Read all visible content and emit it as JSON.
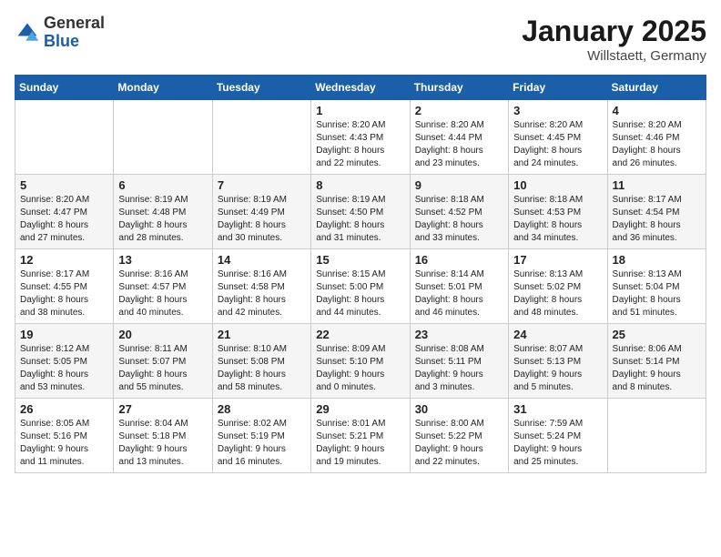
{
  "logo": {
    "general": "General",
    "blue": "Blue"
  },
  "title": "January 2025",
  "location": "Willstaett, Germany",
  "days_of_week": [
    "Sunday",
    "Monday",
    "Tuesday",
    "Wednesday",
    "Thursday",
    "Friday",
    "Saturday"
  ],
  "weeks": [
    [
      {
        "day": "",
        "info": ""
      },
      {
        "day": "",
        "info": ""
      },
      {
        "day": "",
        "info": ""
      },
      {
        "day": "1",
        "info": "Sunrise: 8:20 AM\nSunset: 4:43 PM\nDaylight: 8 hours\nand 22 minutes."
      },
      {
        "day": "2",
        "info": "Sunrise: 8:20 AM\nSunset: 4:44 PM\nDaylight: 8 hours\nand 23 minutes."
      },
      {
        "day": "3",
        "info": "Sunrise: 8:20 AM\nSunset: 4:45 PM\nDaylight: 8 hours\nand 24 minutes."
      },
      {
        "day": "4",
        "info": "Sunrise: 8:20 AM\nSunset: 4:46 PM\nDaylight: 8 hours\nand 26 minutes."
      }
    ],
    [
      {
        "day": "5",
        "info": "Sunrise: 8:20 AM\nSunset: 4:47 PM\nDaylight: 8 hours\nand 27 minutes."
      },
      {
        "day": "6",
        "info": "Sunrise: 8:19 AM\nSunset: 4:48 PM\nDaylight: 8 hours\nand 28 minutes."
      },
      {
        "day": "7",
        "info": "Sunrise: 8:19 AM\nSunset: 4:49 PM\nDaylight: 8 hours\nand 30 minutes."
      },
      {
        "day": "8",
        "info": "Sunrise: 8:19 AM\nSunset: 4:50 PM\nDaylight: 8 hours\nand 31 minutes."
      },
      {
        "day": "9",
        "info": "Sunrise: 8:18 AM\nSunset: 4:52 PM\nDaylight: 8 hours\nand 33 minutes."
      },
      {
        "day": "10",
        "info": "Sunrise: 8:18 AM\nSunset: 4:53 PM\nDaylight: 8 hours\nand 34 minutes."
      },
      {
        "day": "11",
        "info": "Sunrise: 8:17 AM\nSunset: 4:54 PM\nDaylight: 8 hours\nand 36 minutes."
      }
    ],
    [
      {
        "day": "12",
        "info": "Sunrise: 8:17 AM\nSunset: 4:55 PM\nDaylight: 8 hours\nand 38 minutes."
      },
      {
        "day": "13",
        "info": "Sunrise: 8:16 AM\nSunset: 4:57 PM\nDaylight: 8 hours\nand 40 minutes."
      },
      {
        "day": "14",
        "info": "Sunrise: 8:16 AM\nSunset: 4:58 PM\nDaylight: 8 hours\nand 42 minutes."
      },
      {
        "day": "15",
        "info": "Sunrise: 8:15 AM\nSunset: 5:00 PM\nDaylight: 8 hours\nand 44 minutes."
      },
      {
        "day": "16",
        "info": "Sunrise: 8:14 AM\nSunset: 5:01 PM\nDaylight: 8 hours\nand 46 minutes."
      },
      {
        "day": "17",
        "info": "Sunrise: 8:13 AM\nSunset: 5:02 PM\nDaylight: 8 hours\nand 48 minutes."
      },
      {
        "day": "18",
        "info": "Sunrise: 8:13 AM\nSunset: 5:04 PM\nDaylight: 8 hours\nand 51 minutes."
      }
    ],
    [
      {
        "day": "19",
        "info": "Sunrise: 8:12 AM\nSunset: 5:05 PM\nDaylight: 8 hours\nand 53 minutes."
      },
      {
        "day": "20",
        "info": "Sunrise: 8:11 AM\nSunset: 5:07 PM\nDaylight: 8 hours\nand 55 minutes."
      },
      {
        "day": "21",
        "info": "Sunrise: 8:10 AM\nSunset: 5:08 PM\nDaylight: 8 hours\nand 58 minutes."
      },
      {
        "day": "22",
        "info": "Sunrise: 8:09 AM\nSunset: 5:10 PM\nDaylight: 9 hours\nand 0 minutes."
      },
      {
        "day": "23",
        "info": "Sunrise: 8:08 AM\nSunset: 5:11 PM\nDaylight: 9 hours\nand 3 minutes."
      },
      {
        "day": "24",
        "info": "Sunrise: 8:07 AM\nSunset: 5:13 PM\nDaylight: 9 hours\nand 5 minutes."
      },
      {
        "day": "25",
        "info": "Sunrise: 8:06 AM\nSunset: 5:14 PM\nDaylight: 9 hours\nand 8 minutes."
      }
    ],
    [
      {
        "day": "26",
        "info": "Sunrise: 8:05 AM\nSunset: 5:16 PM\nDaylight: 9 hours\nand 11 minutes."
      },
      {
        "day": "27",
        "info": "Sunrise: 8:04 AM\nSunset: 5:18 PM\nDaylight: 9 hours\nand 13 minutes."
      },
      {
        "day": "28",
        "info": "Sunrise: 8:02 AM\nSunset: 5:19 PM\nDaylight: 9 hours\nand 16 minutes."
      },
      {
        "day": "29",
        "info": "Sunrise: 8:01 AM\nSunset: 5:21 PM\nDaylight: 9 hours\nand 19 minutes."
      },
      {
        "day": "30",
        "info": "Sunrise: 8:00 AM\nSunset: 5:22 PM\nDaylight: 9 hours\nand 22 minutes."
      },
      {
        "day": "31",
        "info": "Sunrise: 7:59 AM\nSunset: 5:24 PM\nDaylight: 9 hours\nand 25 minutes."
      },
      {
        "day": "",
        "info": ""
      }
    ]
  ]
}
